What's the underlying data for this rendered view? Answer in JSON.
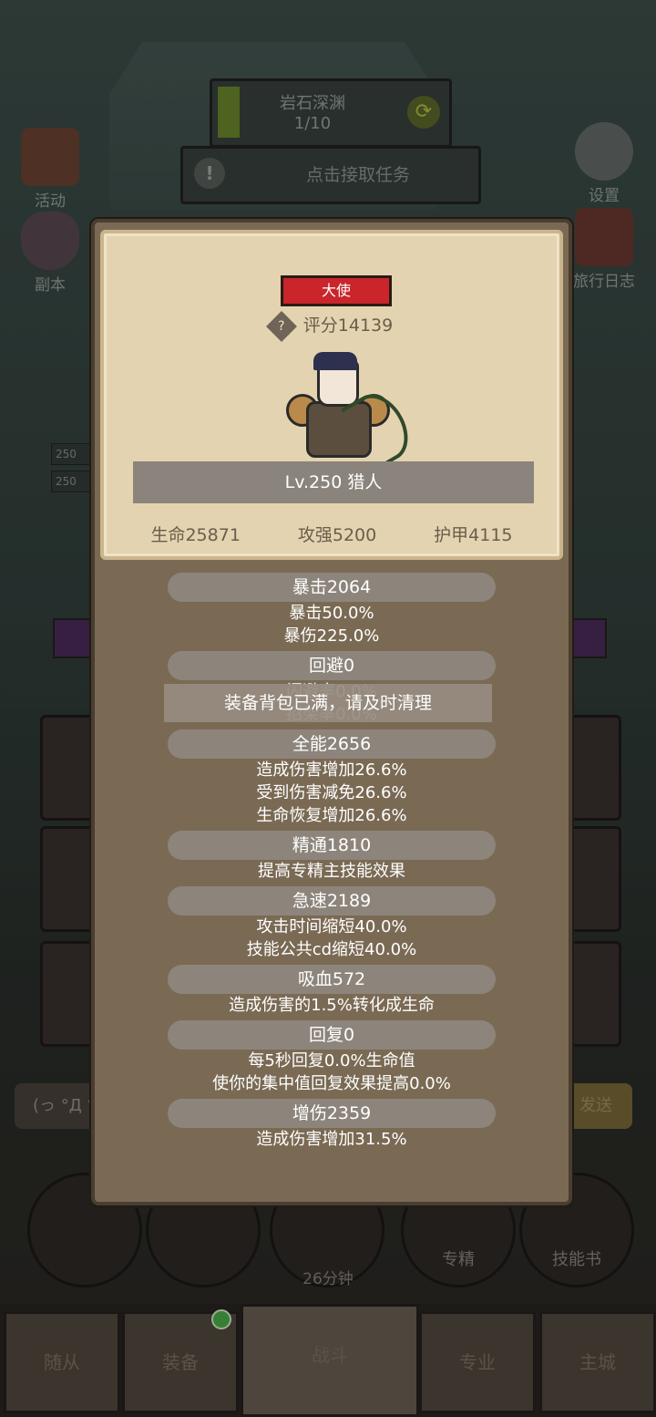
{
  "stage": {
    "name": "岩石深渊",
    "progress": "1/10"
  },
  "task": {
    "label": "点击接取任务"
  },
  "side": {
    "activity": "活动",
    "dungeon": "副本",
    "settings": "设置",
    "journal": "旅行日志"
  },
  "level_chips": [
    "250",
    "250"
  ],
  "chat": {
    "emote": "(っ °Д °",
    "send": "发送"
  },
  "circles": {
    "specialization": "专精",
    "skillbook": "技能书",
    "timer": "26分钟"
  },
  "tabs": {
    "followers": "随从",
    "equipment": "装备",
    "battle": "战斗",
    "profession": "专业",
    "city": "主城"
  },
  "popup": {
    "rank": "大使",
    "score": "评分14139",
    "name": "Lv.250 猎人",
    "hp": "生命25871",
    "attack": "攻强5200",
    "armor": "护甲4115",
    "toast": "装备背包已满，请及时清理",
    "stats": [
      {
        "header": "暴击2064",
        "lines": [
          "暴击50.0%",
          "暴伤225.0%"
        ]
      },
      {
        "header": "回避0",
        "lines": [
          "闪避率0.0%",
          "招架率0.0%"
        ]
      },
      {
        "header": "全能2656",
        "lines": [
          "造成伤害增加26.6%",
          "受到伤害减免26.6%",
          "生命恢复增加26.6%"
        ]
      },
      {
        "header": "精通1810",
        "lines": [
          "提高专精主技能效果"
        ]
      },
      {
        "header": "急速2189",
        "lines": [
          "攻击时间缩短40.0%",
          "技能公共cd缩短40.0%"
        ]
      },
      {
        "header": "吸血572",
        "lines": [
          "造成伤害的1.5%转化成生命"
        ]
      },
      {
        "header": "回复0",
        "lines": [
          "每5秒回复0.0%生命值",
          "使你的集中值回复效果提高0.0%"
        ]
      },
      {
        "header": "增伤2359",
        "lines": [
          "造成伤害增加31.5%"
        ]
      }
    ]
  }
}
